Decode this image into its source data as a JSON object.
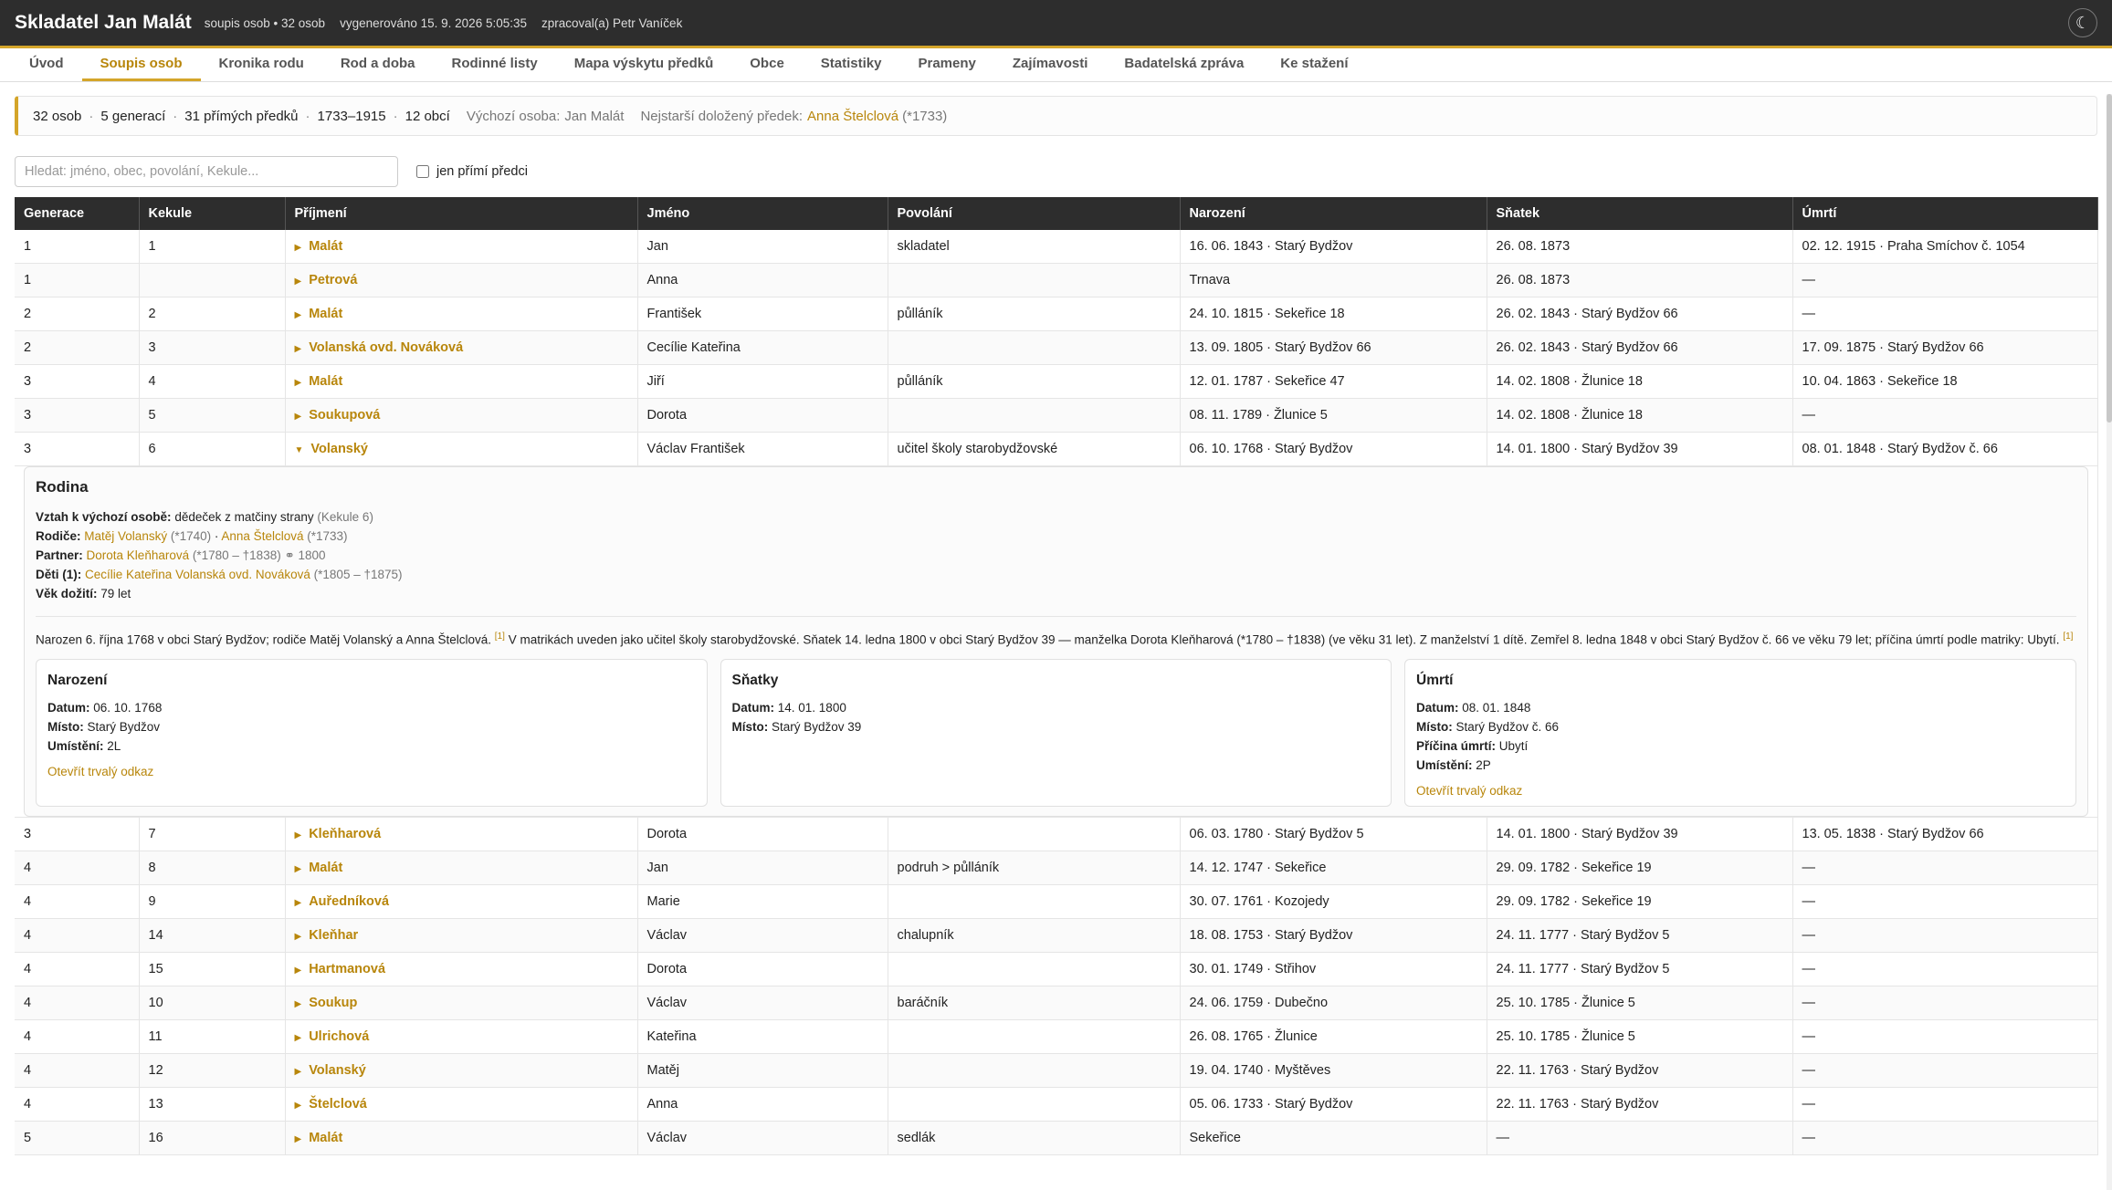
{
  "header": {
    "title": "Skladatel Jan Malát",
    "meta": [
      "soupis osob • 32 osob",
      "vygenerováno 15. 9. 2026 5:05:35",
      "zpracoval(a) Petr Vaníček"
    ],
    "theme_icon": "☾"
  },
  "nav": {
    "tabs": [
      "Úvod",
      "Soupis osob",
      "Kronika rodu",
      "Rod a doba",
      "Rodinné listy",
      "Mapa výskytu předků",
      "Obce",
      "Statistiky",
      "Prameny",
      "Zajímavosti",
      "Badatelská zpráva",
      "Ke stažení"
    ],
    "active": "Soupis osob"
  },
  "summary": {
    "persons": "32 osob",
    "generations": "5 generací",
    "direct": "31 přímých předků",
    "years": "1733–1915",
    "places": "12 obcí",
    "start_label": "Výchozí osoba:",
    "start_value": "Jan Malát",
    "oldest_label": "Nejstarší doložený předek:",
    "oldest_name": "Anna Štelclová",
    "oldest_year": "(*1733)"
  },
  "filters": {
    "search_placeholder": "Hledat: jméno, obec, povolání, Kekule...",
    "checkbox_label": "jen přímí předci",
    "checkbox_checked": false
  },
  "table": {
    "columns": [
      "Generace",
      "Kekule",
      "Příjmení",
      "Jméno",
      "Povolání",
      "Narození",
      "Sňatek",
      "Úmrtí"
    ],
    "rows_before": [
      {
        "gen": "1",
        "kekule": "1",
        "surname": "Malát",
        "name": "Jan",
        "occupation": "skladatel",
        "birth": "16. 06. 1843 · Starý Bydžov",
        "marriage": "26. 08. 1873",
        "death": "02. 12. 1915 · Praha Smíchov č. 1054"
      },
      {
        "gen": "1",
        "kekule": "",
        "surname": "Petrová",
        "name": "Anna",
        "occupation": "",
        "birth": "Trnava",
        "marriage": "26. 08. 1873",
        "death": "—"
      },
      {
        "gen": "2",
        "kekule": "2",
        "surname": "Malát",
        "name": "František",
        "occupation": "půlláník",
        "birth": "24. 10. 1815 · Sekeřice 18",
        "marriage": "26. 02. 1843 · Starý Bydžov 66",
        "death": "—"
      },
      {
        "gen": "2",
        "kekule": "3",
        "surname": "Volanská ovd. Nováková",
        "name": "Cecílie Kateřina",
        "occupation": "",
        "birth": "13. 09. 1805 · Starý Bydžov 66",
        "marriage": "26. 02. 1843 · Starý Bydžov 66",
        "death": "17. 09. 1875 · Starý Bydžov 66"
      },
      {
        "gen": "3",
        "kekule": "4",
        "surname": "Malát",
        "name": "Jiří",
        "occupation": "půlláník",
        "birth": "12. 01. 1787 · Sekeřice 47",
        "marriage": "14. 02. 1808 · Žlunice 18",
        "death": "10. 04. 1863 · Sekeřice 18"
      },
      {
        "gen": "3",
        "kekule": "5",
        "surname": "Soukupová",
        "name": "Dorota",
        "occupation": "",
        "birth": "08. 11. 1789 · Žlunice 5",
        "marriage": "14. 02. 1808 · Žlunice 18",
        "death": "—"
      },
      {
        "gen": "3",
        "kekule": "6",
        "surname": "Volanský",
        "name": "Václav František",
        "occupation": "učitel školy starobydžovské",
        "birth": "06. 10. 1768 · Starý Bydžov",
        "marriage": "14. 01. 1800 · Starý Bydžov 39",
        "death": "08. 01. 1848 · Starý Bydžov č. 66",
        "expanded": true
      }
    ],
    "rows_after": [
      {
        "gen": "3",
        "kekule": "7",
        "surname": "Kleňharová",
        "name": "Dorota",
        "occupation": "",
        "birth": "06. 03. 1780 · Starý Bydžov 5",
        "marriage": "14. 01. 1800 · Starý Bydžov 39",
        "death": "13. 05. 1838 · Starý Bydžov 66"
      },
      {
        "gen": "4",
        "kekule": "8",
        "surname": "Malát",
        "name": "Jan",
        "occupation": "podruh > půlláník",
        "birth": "14. 12. 1747 · Sekeřice",
        "marriage": "29. 09. 1782 · Sekeřice 19",
        "death": "—"
      },
      {
        "gen": "4",
        "kekule": "9",
        "surname": "Auředníková",
        "name": "Marie",
        "occupation": "",
        "birth": "30. 07. 1761 · Kozojedy",
        "marriage": "29. 09. 1782 · Sekeřice 19",
        "death": "—"
      },
      {
        "gen": "4",
        "kekule": "14",
        "surname": "Kleňhar",
        "name": "Václav",
        "occupation": "chalupník",
        "birth": "18. 08. 1753 · Starý Bydžov",
        "marriage": "24. 11. 1777 · Starý Bydžov 5",
        "death": "—"
      },
      {
        "gen": "4",
        "kekule": "15",
        "surname": "Hartmanová",
        "name": "Dorota",
        "occupation": "",
        "birth": "30. 01. 1749 · Střihov",
        "marriage": "24. 11. 1777 · Starý Bydžov 5",
        "death": "—"
      },
      {
        "gen": "4",
        "kekule": "10",
        "surname": "Soukup",
        "name": "Václav",
        "occupation": "baráčník",
        "birth": "24. 06. 1759 · Dubečno",
        "marriage": "25. 10. 1785 · Žlunice 5",
        "death": "—"
      },
      {
        "gen": "4",
        "kekule": "11",
        "surname": "Ulrichová",
        "name": "Kateřina",
        "occupation": "",
        "birth": "26. 08. 1765 · Žlunice",
        "marriage": "25. 10. 1785 · Žlunice 5",
        "death": "—"
      },
      {
        "gen": "4",
        "kekule": "12",
        "surname": "Volanský",
        "name": "Matěj",
        "occupation": "",
        "birth": "19. 04. 1740 · Myštěves",
        "marriage": "22. 11. 1763 · Starý Bydžov",
        "death": "—"
      },
      {
        "gen": "4",
        "kekule": "13",
        "surname": "Štelclová",
        "name": "Anna",
        "occupation": "",
        "birth": "05. 06. 1733 · Starý Bydžov",
        "marriage": "22. 11. 1763 · Starý Bydžov",
        "death": "—"
      },
      {
        "gen": "5",
        "kekule": "16",
        "surname": "Malát",
        "name": "Václav",
        "occupation": "sedlák",
        "birth": "Sekeřice",
        "marriage": "—",
        "death": "—"
      }
    ]
  },
  "detail": {
    "title": "Rodina",
    "relation_label": "Vztah k výchozí osobě:",
    "relation_value": "dědeček z matčiny strany",
    "relation_note": "(Kekule 6)",
    "parents_label": "Rodiče:",
    "father_name": "Matěj Volanský",
    "father_years": "(*1740)",
    "parents_sep": "·",
    "mother_name": "Anna Štelclová",
    "mother_years": "(*1733)",
    "partner_label": "Partner:",
    "partner_name": "Dorota Kleňharová",
    "partner_years": "(*1780 – †1838) ⚭ 1800",
    "children_label": "Děti (1):",
    "child_name": "Cecílie Kateřina Volanská ovd. Nováková",
    "child_years": "(*1805 – †1875)",
    "age_label": "Věk dožití:",
    "age_value": "79 let",
    "bio_part1": "Narozen 6. října 1768 v obci Starý Bydžov; rodiče Matěj Volanský a Anna Štelclová.",
    "bio_ref1": "[1]",
    "bio_part2": "V matrikách uveden jako učitel školy starobydžovské. Sňatek 14. ledna 1800 v obci Starý Bydžov 39 — manželka Dorota Kleňharová (*1780 – †1838) (ve věku 31 let). Z manželství 1 dítě. Zemřel 8. ledna 1848 v obci Starý Bydžov č. 66 ve věku 79 let; příčina úmrtí podle matriky: Ubytí.",
    "bio_ref2": "[1]",
    "birth_card": {
      "title": "Narození",
      "date_label": "Datum:",
      "date": "06. 10. 1768",
      "place_label": "Místo:",
      "place": "Starý Bydžov",
      "pos_label": "Umístění:",
      "pos": "2L",
      "link": "Otevřít trvalý odkaz"
    },
    "marriage_card": {
      "title": "Sňatky",
      "date_label": "Datum:",
      "date": "14. 01. 1800",
      "place_label": "Místo:",
      "place": "Starý Bydžov 39"
    },
    "death_card": {
      "title": "Úmrtí",
      "date_label": "Datum:",
      "date": "08. 01. 1848",
      "place_label": "Místo:",
      "place": "Starý Bydžov č. 66",
      "cause_label": "Příčina úmrtí:",
      "cause": "Ubytí",
      "pos_label": "Umístění:",
      "pos": "2P",
      "link": "Otevřít trvalý odkaz"
    }
  }
}
